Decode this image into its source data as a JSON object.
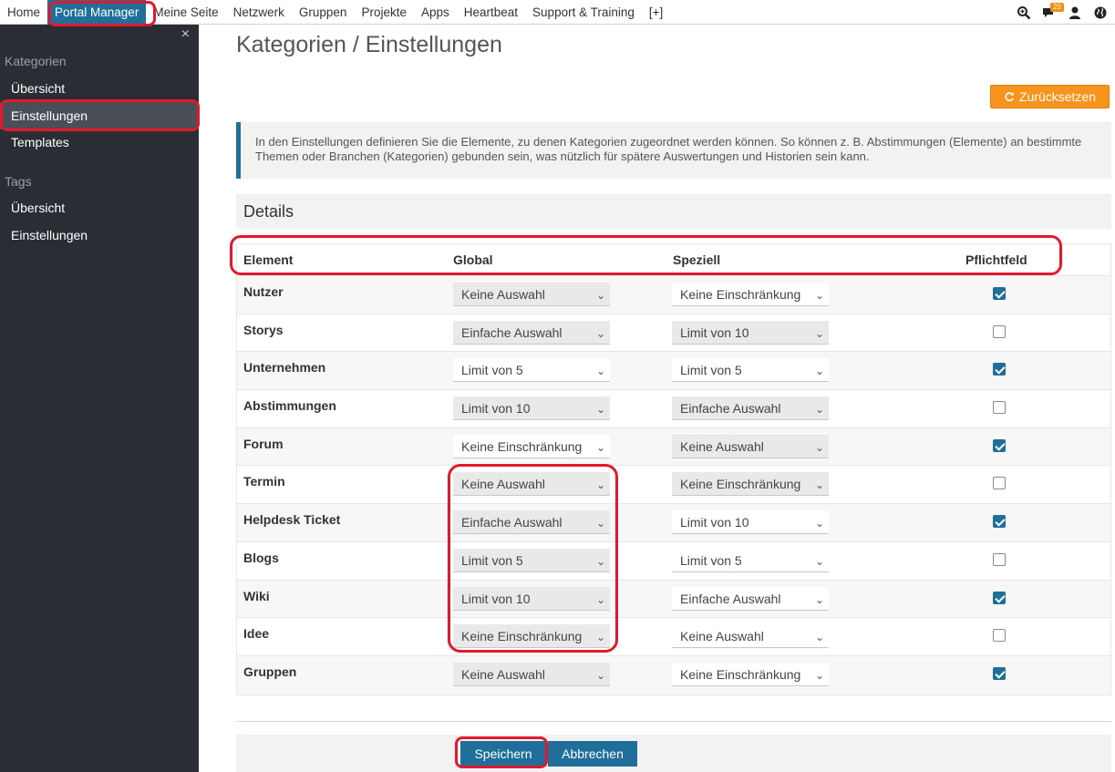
{
  "topnav": {
    "items": [
      "Home",
      "Portal Manager",
      "Meine Seite",
      "Netzwerk",
      "Gruppen",
      "Projekte",
      "Apps",
      "Heartbeat",
      "Support & Training",
      "[+]"
    ],
    "active_index": 1,
    "icons": [
      "search-icon",
      "chat-icon",
      "user-icon",
      "globe-icon"
    ],
    "chat_badge": "20"
  },
  "sidebar": {
    "close": "×",
    "sections": [
      {
        "title": "Kategorien",
        "items": [
          "Übersicht",
          "Einstellungen",
          "Templates"
        ]
      },
      {
        "title": "Tags",
        "items": [
          "Übersicht",
          "Einstellungen"
        ]
      }
    ],
    "active": "Kategorien/Einstellungen"
  },
  "main": {
    "title": "Kategorien / Einstellungen",
    "reset_label": "Zurücksetzen",
    "info": "In den Einstellungen definieren Sie die Elemente, zu denen Kategorien zugeordnet werden können. So können z. B. Abstimmungen (Elemente) an bestimmte Themen oder Branchen (Kategorien) gebunden sein, was nützlich für spätere Auswertungen und Historien sein kann.",
    "details_title": "Details",
    "columns": {
      "element": "Element",
      "global": "Global",
      "special": "Speziell",
      "required": "Pflichtfeld"
    },
    "rows": [
      {
        "name": "Nutzer",
        "global": "Keine Auswahl",
        "global_gray": true,
        "special": "Keine Einschränkung",
        "special_gray": false,
        "required": true
      },
      {
        "name": "Storys",
        "global": "Einfache Auswahl",
        "global_gray": true,
        "special": "Limit von 10",
        "special_gray": true,
        "required": false
      },
      {
        "name": "Unternehmen",
        "global": "Limit von 5",
        "global_gray": false,
        "special": "Limit von 5",
        "special_gray": false,
        "required": true
      },
      {
        "name": "Abstimmungen",
        "global": "Limit von 10",
        "global_gray": true,
        "special": "Einfache Auswahl",
        "special_gray": true,
        "required": false
      },
      {
        "name": "Forum",
        "global": "Keine Einschränkung",
        "global_gray": false,
        "special": "Keine Auswahl",
        "special_gray": true,
        "required": true
      },
      {
        "name": "Termin",
        "global": "Keine Auswahl",
        "global_gray": true,
        "special": "Keine Einschränkung",
        "special_gray": true,
        "required": false
      },
      {
        "name": "Helpdesk Ticket",
        "global": "Einfache Auswahl",
        "global_gray": true,
        "special": "Limit von 10",
        "special_gray": false,
        "required": true
      },
      {
        "name": "Blogs",
        "global": "Limit von 5",
        "global_gray": true,
        "special": "Limit von 5",
        "special_gray": false,
        "required": false
      },
      {
        "name": "Wiki",
        "global": "Limit von 10",
        "global_gray": true,
        "special": "Einfache Auswahl",
        "special_gray": false,
        "required": true
      },
      {
        "name": "Idee",
        "global": "Keine Einschränkung",
        "global_gray": true,
        "special": "Keine Auswahl",
        "special_gray": false,
        "required": false
      },
      {
        "name": "Gruppen",
        "global": "Keine Auswahl",
        "global_gray": true,
        "special": "Keine Einschränkung",
        "special_gray": false,
        "required": true
      }
    ],
    "save_label": "Speichern",
    "cancel_label": "Abbrechen"
  },
  "colors": {
    "accent": "#1f6f9a",
    "reset": "#f7941d",
    "sidebar_bg": "#2a2d33",
    "annotation": "#e2192b"
  }
}
